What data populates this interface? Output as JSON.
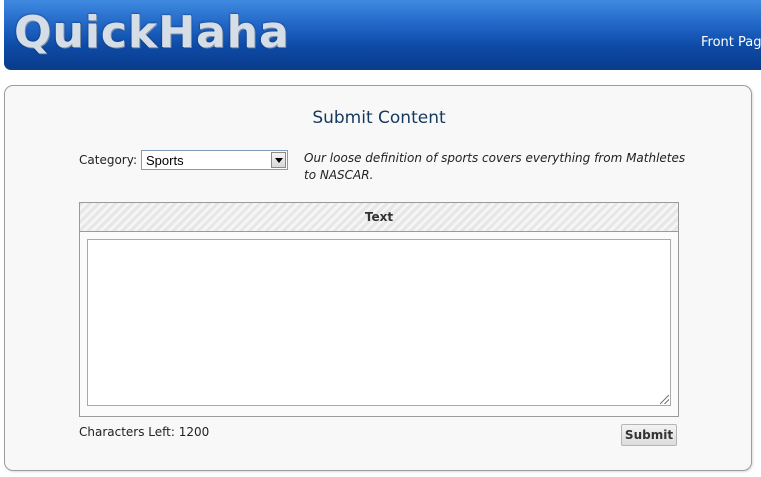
{
  "header": {
    "logo": "QuickHaha",
    "nav_link": "Front Page"
  },
  "form": {
    "title": "Submit Content",
    "category_label": "Category:",
    "category_selected": "Sports",
    "category_description": "Our loose definition of sports covers everything from Mathletes to NASCAR.",
    "text_header": "Text",
    "text_value": "",
    "chars_left_label": "Characters Left:",
    "chars_left_value": "1200",
    "submit_label": "Submit"
  }
}
